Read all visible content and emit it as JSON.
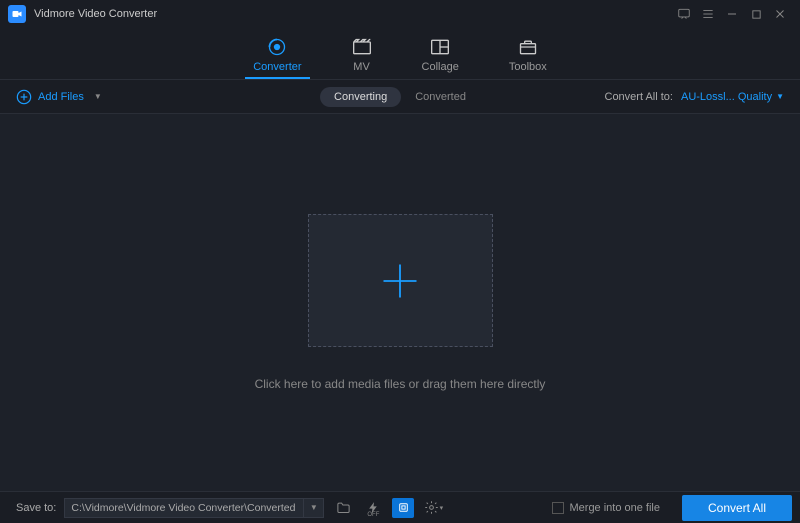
{
  "titlebar": {
    "title": "Vidmore Video Converter"
  },
  "nav": {
    "converter": "Converter",
    "mv": "MV",
    "collage": "Collage",
    "toolbox": "Toolbox"
  },
  "secondary": {
    "add_files": "Add Files",
    "converting": "Converting",
    "converted": "Converted",
    "convert_all_to_label": "Convert All to:",
    "format_selected": "AU-Lossl... Quality"
  },
  "main": {
    "drop_hint": "Click here to add media files or drag them here directly"
  },
  "bottom": {
    "save_to_label": "Save to:",
    "save_path": "C:\\Vidmore\\Vidmore Video Converter\\Converted",
    "merge_label": "Merge into one file",
    "convert_all_btn": "Convert All"
  }
}
